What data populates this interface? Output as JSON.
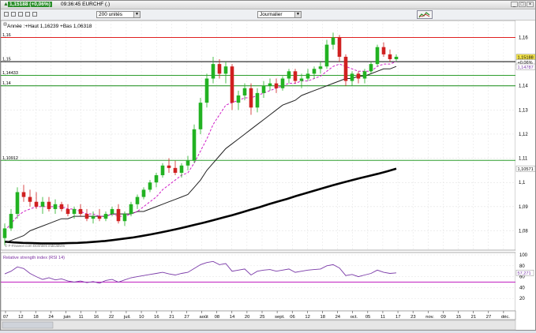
{
  "window": {
    "price_badge": "1,15188 (+0,06%)",
    "title": "09:36:45 EURCHF (.)",
    "min_label": "_",
    "max_label": "□",
    "close_label": "×"
  },
  "toolbar": {
    "period_value": "200 unités",
    "interval_value": "Journalier"
  },
  "chart_data": [
    {
      "type": "candlestick",
      "title": "Année :+Haut 1,16239 +Bas 1,06318",
      "y_ticks": [
        "1,16",
        "1,15",
        "1,14",
        "1,13",
        "1,12",
        "1,11",
        "1,1",
        "1,09",
        "1,08"
      ],
      "ylim": [
        1.072,
        1.167
      ],
      "x_ticks": [
        "07",
        "12",
        "18",
        "24",
        "juin",
        "11",
        "16",
        "22",
        "juil.",
        "10",
        "16",
        "21",
        "27",
        "août",
        "08",
        "14",
        "20",
        "25",
        "sept.",
        "06",
        "12",
        "18",
        "24",
        "oct.",
        "05",
        "11",
        "17",
        "23",
        "nov.",
        "09",
        "15",
        "21",
        "27",
        "déc."
      ],
      "horizontal_lines": [
        {
          "value": 1.16,
          "label": "1,16",
          "color": "#e02020"
        },
        {
          "value": 1.15,
          "label": "1,15",
          "color": "#000000"
        },
        {
          "value": 1.14433,
          "label": "1,14433",
          "color": "#2e9e2e"
        },
        {
          "value": 1.14,
          "label": "1,14",
          "color": "#138a13"
        },
        {
          "value": 1.10912,
          "label": "1,10912",
          "color": "#2e9e2e"
        }
      ],
      "price_labels": [
        {
          "value": 1.15188,
          "text": "1,15188",
          "bg": "#f3e34a"
        },
        {
          "value": 1.1497,
          "text": "+0,06%",
          "bg": "#ffffff"
        },
        {
          "value": 1.14787,
          "text": "1,14787",
          "bg": "#ffffff",
          "color": "#7a3aa8"
        },
        {
          "value": 1.10571,
          "text": "1,10571",
          "bg": "#ffffff"
        }
      ],
      "candles": [
        {
          "o": 1.077,
          "h": 1.083,
          "l": 1.074,
          "c": 1.081
        },
        {
          "o": 1.081,
          "h": 1.089,
          "l": 1.08,
          "c": 1.087
        },
        {
          "o": 1.087,
          "h": 1.098,
          "l": 1.085,
          "c": 1.096
        },
        {
          "o": 1.096,
          "h": 1.099,
          "l": 1.092,
          "c": 1.094
        },
        {
          "o": 1.094,
          "h": 1.097,
          "l": 1.09,
          "c": 1.092
        },
        {
          "o": 1.092,
          "h": 1.096,
          "l": 1.089,
          "c": 1.09
        },
        {
          "o": 1.09,
          "h": 1.094,
          "l": 1.087,
          "c": 1.092
        },
        {
          "o": 1.092,
          "h": 1.094,
          "l": 1.088,
          "c": 1.089
        },
        {
          "o": 1.089,
          "h": 1.093,
          "l": 1.087,
          "c": 1.091
        },
        {
          "o": 1.091,
          "h": 1.092,
          "l": 1.088,
          "c": 1.089
        },
        {
          "o": 1.089,
          "h": 1.091,
          "l": 1.086,
          "c": 1.087
        },
        {
          "o": 1.087,
          "h": 1.09,
          "l": 1.085,
          "c": 1.089
        },
        {
          "o": 1.089,
          "h": 1.091,
          "l": 1.086,
          "c": 1.087
        },
        {
          "o": 1.087,
          "h": 1.089,
          "l": 1.084,
          "c": 1.085
        },
        {
          "o": 1.085,
          "h": 1.088,
          "l": 1.083,
          "c": 1.086
        },
        {
          "o": 1.086,
          "h": 1.089,
          "l": 1.084,
          "c": 1.085
        },
        {
          "o": 1.085,
          "h": 1.088,
          "l": 1.084,
          "c": 1.087
        },
        {
          "o": 1.087,
          "h": 1.09,
          "l": 1.086,
          "c": 1.089
        },
        {
          "o": 1.089,
          "h": 1.091,
          "l": 1.083,
          "c": 1.084
        },
        {
          "o": 1.084,
          "h": 1.088,
          "l": 1.082,
          "c": 1.087
        },
        {
          "o": 1.087,
          "h": 1.092,
          "l": 1.086,
          "c": 1.091
        },
        {
          "o": 1.091,
          "h": 1.095,
          "l": 1.089,
          "c": 1.094
        },
        {
          "o": 1.094,
          "h": 1.098,
          "l": 1.093,
          "c": 1.097
        },
        {
          "o": 1.097,
          "h": 1.101,
          "l": 1.096,
          "c": 1.1
        },
        {
          "o": 1.1,
          "h": 1.104,
          "l": 1.098,
          "c": 1.103
        },
        {
          "o": 1.103,
          "h": 1.108,
          "l": 1.102,
          "c": 1.107
        },
        {
          "o": 1.107,
          "h": 1.11,
          "l": 1.104,
          "c": 1.106
        },
        {
          "o": 1.106,
          "h": 1.109,
          "l": 1.103,
          "c": 1.104
        },
        {
          "o": 1.104,
          "h": 1.108,
          "l": 1.102,
          "c": 1.107
        },
        {
          "o": 1.107,
          "h": 1.111,
          "l": 1.105,
          "c": 1.109
        },
        {
          "o": 1.109,
          "h": 1.124,
          "l": 1.108,
          "c": 1.122
        },
        {
          "o": 1.122,
          "h": 1.135,
          "l": 1.12,
          "c": 1.133
        },
        {
          "o": 1.133,
          "h": 1.145,
          "l": 1.131,
          "c": 1.143
        },
        {
          "o": 1.143,
          "h": 1.152,
          "l": 1.141,
          "c": 1.149
        },
        {
          "o": 1.149,
          "h": 1.151,
          "l": 1.143,
          "c": 1.145
        },
        {
          "o": 1.145,
          "h": 1.15,
          "l": 1.141,
          "c": 1.148
        },
        {
          "o": 1.148,
          "h": 1.149,
          "l": 1.13,
          "c": 1.133
        },
        {
          "o": 1.133,
          "h": 1.138,
          "l": 1.13,
          "c": 1.136
        },
        {
          "o": 1.136,
          "h": 1.141,
          "l": 1.134,
          "c": 1.139
        },
        {
          "o": 1.139,
          "h": 1.141,
          "l": 1.128,
          "c": 1.131
        },
        {
          "o": 1.131,
          "h": 1.139,
          "l": 1.129,
          "c": 1.137
        },
        {
          "o": 1.137,
          "h": 1.142,
          "l": 1.135,
          "c": 1.14
        },
        {
          "o": 1.14,
          "h": 1.143,
          "l": 1.138,
          "c": 1.141
        },
        {
          "o": 1.141,
          "h": 1.143,
          "l": 1.137,
          "c": 1.139
        },
        {
          "o": 1.139,
          "h": 1.144,
          "l": 1.138,
          "c": 1.143
        },
        {
          "o": 1.143,
          "h": 1.147,
          "l": 1.141,
          "c": 1.146
        },
        {
          "o": 1.146,
          "h": 1.147,
          "l": 1.141,
          "c": 1.142
        },
        {
          "o": 1.142,
          "h": 1.145,
          "l": 1.139,
          "c": 1.143
        },
        {
          "o": 1.143,
          "h": 1.147,
          "l": 1.142,
          "c": 1.145
        },
        {
          "o": 1.145,
          "h": 1.148,
          "l": 1.143,
          "c": 1.147
        },
        {
          "o": 1.147,
          "h": 1.15,
          "l": 1.145,
          "c": 1.148
        },
        {
          "o": 1.148,
          "h": 1.159,
          "l": 1.147,
          "c": 1.157
        },
        {
          "o": 1.157,
          "h": 1.162,
          "l": 1.155,
          "c": 1.16
        },
        {
          "o": 1.16,
          "h": 1.161,
          "l": 1.15,
          "c": 1.152
        },
        {
          "o": 1.152,
          "h": 1.153,
          "l": 1.14,
          "c": 1.142
        },
        {
          "o": 1.142,
          "h": 1.146,
          "l": 1.14,
          "c": 1.145
        },
        {
          "o": 1.145,
          "h": 1.146,
          "l": 1.141,
          "c": 1.143
        },
        {
          "o": 1.143,
          "h": 1.147,
          "l": 1.141,
          "c": 1.146
        },
        {
          "o": 1.146,
          "h": 1.15,
          "l": 1.145,
          "c": 1.149
        },
        {
          "o": 1.149,
          "h": 1.157,
          "l": 1.148,
          "c": 1.156
        },
        {
          "o": 1.156,
          "h": 1.158,
          "l": 1.152,
          "c": 1.153
        },
        {
          "o": 1.153,
          "h": 1.155,
          "l": 1.15,
          "c": 1.151
        },
        {
          "o": 1.151,
          "h": 1.153,
          "l": 1.15,
          "c": 1.152
        }
      ],
      "ma_fast": [
        1.08,
        1.083,
        1.086,
        1.088,
        1.089,
        1.09,
        1.09,
        1.09,
        1.09,
        1.09,
        1.089,
        1.089,
        1.088,
        1.087,
        1.087,
        1.086,
        1.086,
        1.087,
        1.086,
        1.086,
        1.087,
        1.088,
        1.09,
        1.092,
        1.094,
        1.097,
        1.099,
        1.101,
        1.103,
        1.104,
        1.108,
        1.113,
        1.118,
        1.124,
        1.128,
        1.132,
        1.133,
        1.134,
        1.135,
        1.135,
        1.136,
        1.137,
        1.138,
        1.139,
        1.14,
        1.141,
        1.141,
        1.142,
        1.142,
        1.143,
        1.144,
        1.146,
        1.148,
        1.149,
        1.148,
        1.147,
        1.146,
        1.146,
        1.146,
        1.148,
        1.149,
        1.149,
        1.15
      ],
      "ma_mid": [
        1.075,
        1.076,
        1.077,
        1.078,
        1.08,
        1.081,
        1.082,
        1.083,
        1.084,
        1.085,
        1.085,
        1.086,
        1.086,
        1.086,
        1.086,
        1.086,
        1.086,
        1.087,
        1.087,
        1.087,
        1.087,
        1.088,
        1.088,
        1.089,
        1.09,
        1.091,
        1.092,
        1.093,
        1.094,
        1.095,
        1.098,
        1.101,
        1.105,
        1.108,
        1.111,
        1.114,
        1.116,
        1.118,
        1.12,
        1.122,
        1.124,
        1.126,
        1.128,
        1.13,
        1.132,
        1.133,
        1.134,
        1.136,
        1.137,
        1.138,
        1.139,
        1.14,
        1.141,
        1.142,
        1.143,
        1.143,
        1.144,
        1.144,
        1.145,
        1.146,
        1.147,
        1.147,
        1.148
      ],
      "ma_slow": [
        1.0755,
        1.0752,
        1.075,
        1.0749,
        1.0748,
        1.0748,
        1.0748,
        1.0749,
        1.075,
        1.0752,
        1.0755,
        1.0758,
        1.0762,
        1.0767,
        1.0772,
        1.0778,
        1.0785,
        1.0792,
        1.08,
        1.0808,
        1.0817,
        1.0826,
        1.0835,
        1.0845,
        1.0855,
        1.0865,
        1.0876,
        1.0887,
        1.0898,
        1.091,
        1.0921,
        1.0932,
        1.0944,
        1.0955,
        1.0966,
        1.0977,
        1.0988,
        1.0998,
        1.1008,
        1.1018,
        1.1027,
        1.1036,
        1.1046,
        1.1057
      ]
    },
    {
      "type": "line",
      "title": "Relative strength index (RSI 14)",
      "y_ticks": [
        "100",
        "80",
        "60",
        "40",
        "20"
      ],
      "ylim": [
        0,
        100
      ],
      "hline": 50,
      "value_label": "57,271",
      "values": [
        65,
        70,
        78,
        75,
        66,
        60,
        55,
        58,
        54,
        56,
        52,
        50,
        52,
        49,
        51,
        48,
        53,
        55,
        50,
        54,
        58,
        60,
        62,
        64,
        66,
        68,
        65,
        63,
        66,
        68,
        75,
        82,
        86,
        88,
        82,
        84,
        70,
        72,
        74,
        63,
        70,
        72,
        73,
        70,
        72,
        74,
        68,
        70,
        72,
        73,
        74,
        80,
        82,
        76,
        62,
        64,
        60,
        63,
        66,
        72,
        68,
        66,
        67
      ]
    }
  ]
}
